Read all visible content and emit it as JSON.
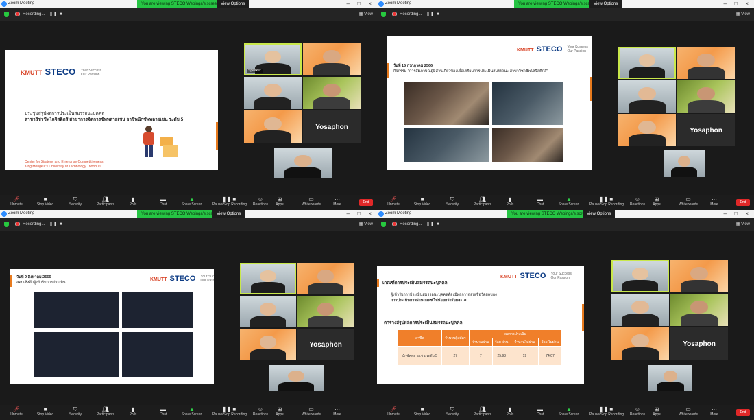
{
  "window": {
    "title": "Zoom Meeting",
    "viewing_banner": "You are viewing STECO Webinga's screen",
    "view_options": "View Options",
    "recording_label": "Recording...",
    "view_button": "View"
  },
  "toolbar": {
    "items": [
      "Unmute",
      "Stop Video",
      "Security",
      "Participants",
      "Polls",
      "Chat",
      "Share Screen",
      "Pause/Stop Recording",
      "Reactions",
      "Apps",
      "Whiteboards",
      "More"
    ],
    "end_label": "End"
  },
  "participants": {
    "yosaphon": "Yosaphon"
  },
  "brand": {
    "name": "STECO",
    "kmutt": "KMUTT",
    "tagline_1": "Your Success",
    "tagline_2": "Our Passion",
    "accent_color": "#e87b1e"
  },
  "slide1": {
    "line1": "ประชุมสรุปผลการประเมินสมรรถนะบุคคล",
    "line2": "สาขาวิชาชีพโลจิสติกส์ สาขาการจัดการซัพพลายเชน อาชีพนักซัพพลายเชน ระดับ 5",
    "footer1": "Center for Strategy and Enterprise Competitiveness",
    "footer2": "King Mongkut's University of Technology Thonburi"
  },
  "slide2": {
    "date": "วันที่ 15 กรกฎาคม 2566",
    "activity": "กิจกรรม \"การสัมภาษณ์ผู้มีส่วนเกี่ยวข้องเพื่อเตรียมการประเมินสมรรถนะ สาขาวิชาชีพโลจิสติกส์\""
  },
  "slide3": {
    "date": "วันที่ 9 สิงหาคม 2566",
    "activity": "สอบเชิงลึกผู้เข้ารับการประเมิน"
  },
  "slide4": {
    "title": "เกณฑ์การประเมินสมรรถนะบุคคล",
    "desc_1": "ผู้เข้ารับการประเมินสมรรถนะบุคคลต้องมีผลการสอบเชื่อวัดผลของ",
    "desc_2": "การประเมินการผ่านเกณฑ์ไม่น้อยกว่าร้อยละ 70",
    "table_title": "ตารางสรุปผลการประเมินสมรรถนะบุคคล",
    "headers": [
      "อาชีพ",
      "จำนวนผู้สมัคร",
      "ผลการประเมิน"
    ],
    "subheaders": [
      "จำนวนผ่าน",
      "ร้อย ผ่าน",
      "จำนวนไม่ผ่าน",
      "ร้อย ไม่ผ่าน"
    ],
    "row": [
      "นักซัพพลายเชน ระดับ 5",
      "27",
      "7",
      "25.93",
      "19",
      "74.07"
    ]
  }
}
